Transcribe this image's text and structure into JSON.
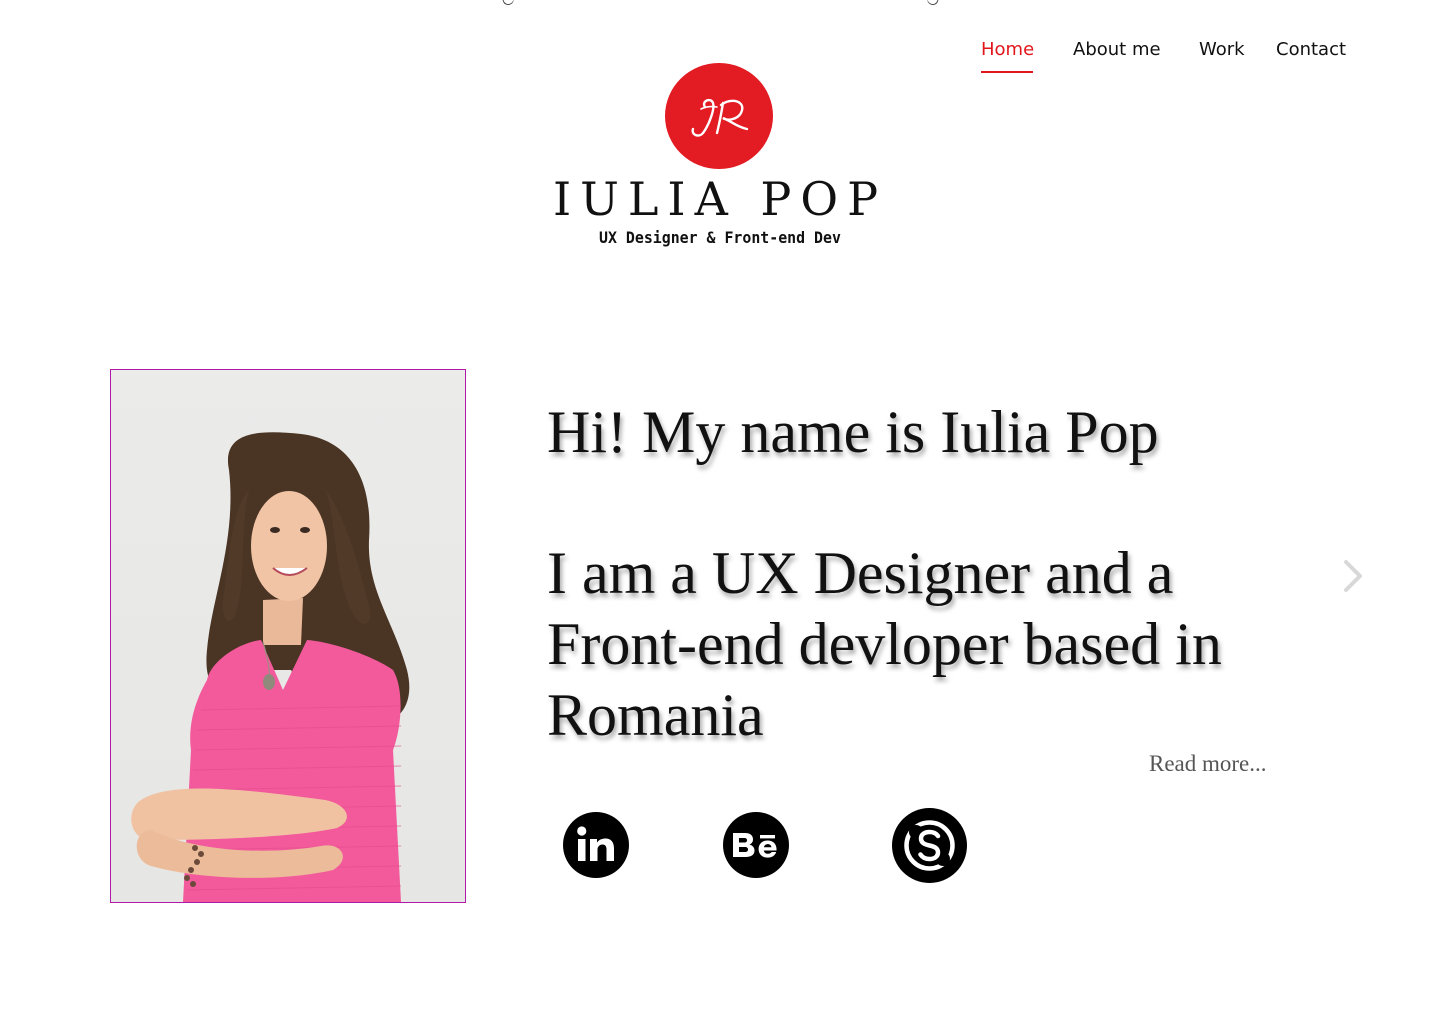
{
  "nav": {
    "items": [
      {
        "label": "Home",
        "active": true
      },
      {
        "label": "About me",
        "active": false
      },
      {
        "label": "Work",
        "active": false
      },
      {
        "label": "Contact",
        "active": false
      }
    ]
  },
  "logo": {
    "monogram": "IP",
    "name": "IULIA POP",
    "tagline": "UX Designer & Front-end Dev",
    "circle_color": "#e31b23"
  },
  "hero": {
    "greeting": "Hi! My name is Iulia Pop",
    "intro": "I am a UX Designer and a Front-end devloper based in Romania",
    "read_more": "Read more..."
  },
  "portrait": {
    "icon": "portrait-photo",
    "border_color": "#b01aa8",
    "shirt_color": "#f25a9c"
  },
  "carousel": {
    "next_icon": "chevron-right-icon"
  },
  "social": [
    {
      "icon": "linkedin-icon",
      "glyph": "in"
    },
    {
      "icon": "behance-icon",
      "glyph": "Bē"
    },
    {
      "icon": "skype-icon",
      "glyph": "S"
    }
  ],
  "colors": {
    "accent": "#e0161c",
    "text": "#111111",
    "muted": "#555555"
  }
}
